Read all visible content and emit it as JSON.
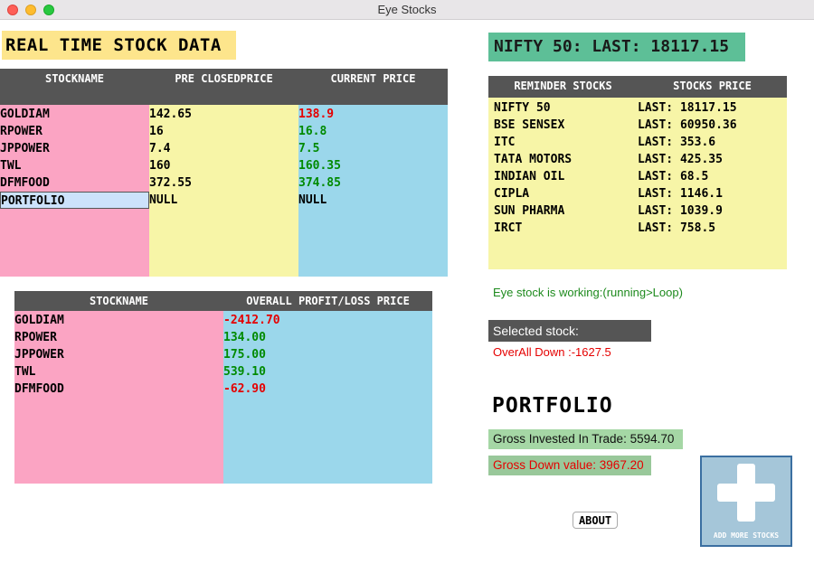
{
  "window": {
    "title": "Eye Stocks"
  },
  "realtime": {
    "title": "REAL TIME STOCK DATA",
    "headers": [
      "STOCKNAME",
      "PRE CLOSEDPRICE",
      "CURRENT PRICE"
    ],
    "rows": [
      {
        "name": "GOLDIAM",
        "pre": "142.65",
        "current": "138.9",
        "trend": "down"
      },
      {
        "name": "RPOWER",
        "pre": "16",
        "current": "16.8",
        "trend": "up"
      },
      {
        "name": "JPPOWER",
        "pre": "7.4",
        "current": "7.5",
        "trend": "up"
      },
      {
        "name": "TWL",
        "pre": "160",
        "current": "160.35",
        "trend": "up"
      },
      {
        "name": "DFMFOOD",
        "pre": "372.55",
        "current": "374.85",
        "trend": "up"
      },
      {
        "name": "PORTFOLIO",
        "pre": "NULL",
        "current": "NULL",
        "trend": "none"
      }
    ]
  },
  "profitloss": {
    "headers": [
      "STOCKNAME",
      "OVERALL PROFIT/LOSS PRICE"
    ],
    "rows": [
      {
        "name": "GOLDIAM",
        "value": "-2412.70",
        "trend": "down"
      },
      {
        "name": "RPOWER",
        "value": "134.00",
        "trend": "up"
      },
      {
        "name": "JPPOWER",
        "value": "175.00",
        "trend": "up"
      },
      {
        "name": "TWL",
        "value": "539.10",
        "trend": "up"
      },
      {
        "name": "DFMFOOD",
        "value": "-62.90",
        "trend": "down"
      }
    ]
  },
  "nifty": {
    "banner": "NIFTY 50: LAST: 18117.15"
  },
  "reminder": {
    "headers": [
      "REMINDER STOCKS",
      "STOCKS PRICE"
    ],
    "rows": [
      {
        "name": "NIFTY 50",
        "price": "LAST: 18117.15"
      },
      {
        "name": "BSE SENSEX",
        "price": "LAST: 60950.36"
      },
      {
        "name": "ITC",
        "price": "LAST: 353.6"
      },
      {
        "name": "TATA MOTORS",
        "price": "LAST: 425.35"
      },
      {
        "name": "INDIAN OIL",
        "price": "LAST: 68.5"
      },
      {
        "name": "CIPLA",
        "price": "LAST: 1146.1"
      },
      {
        "name": "SUN PHARMA",
        "price": "LAST: 1039.9"
      },
      {
        "name": "IRCT",
        "price": "LAST: 758.5"
      }
    ]
  },
  "status": {
    "working": "Eye stock is working:(running>Loop)",
    "selected": "Selected stock: PORTFOLIO",
    "overall": "OverAll Down :-1627.5"
  },
  "portfolio": {
    "title": "PORTFOLIO",
    "gross_invested": "Gross Invested In Trade: 5594.70",
    "gross_down": "Gross Down value: 3967.20"
  },
  "buttons": {
    "about": "ABOUT",
    "add_more": "ADD MORE STOCKS"
  },
  "colors": {
    "up": "#008a00",
    "down": "#e50000",
    "accent_green": "#5dbf97"
  }
}
